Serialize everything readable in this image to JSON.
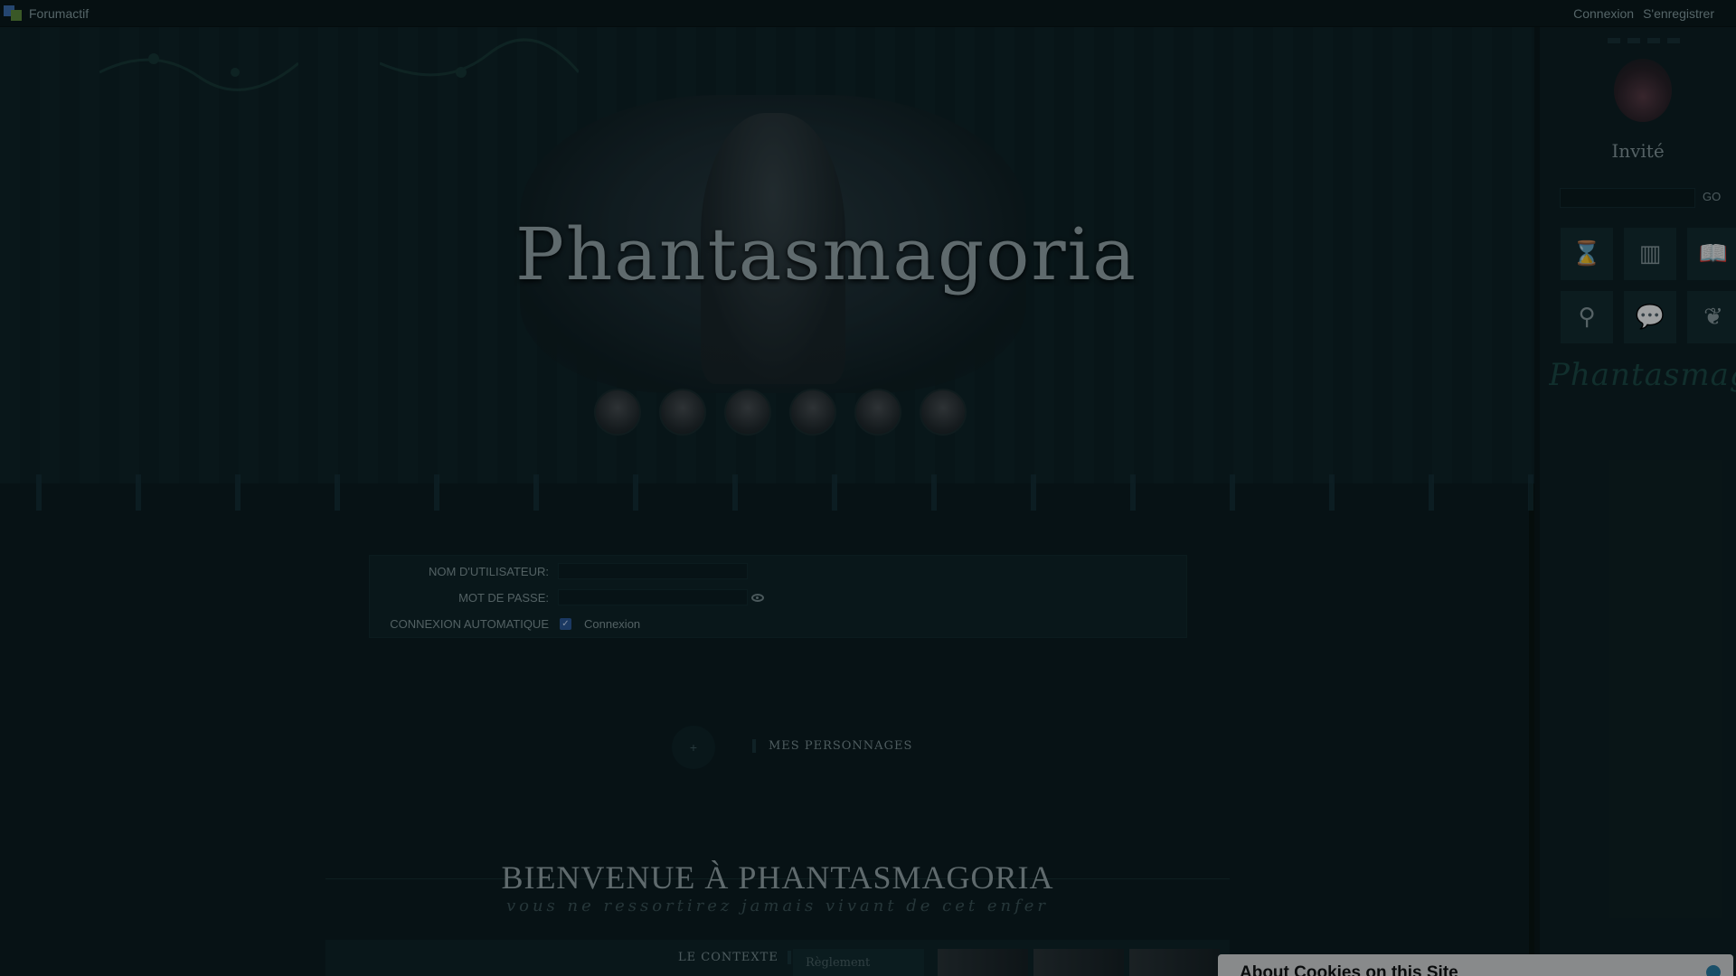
{
  "topbar": {
    "brand": "Forumactif",
    "connexion": "Connexion",
    "register": "S'enregistrer"
  },
  "header": {
    "title": "Phantasmagoria",
    "avatar_count": 6
  },
  "login": {
    "username_label": "NOM D'UTILISATEUR:",
    "password_label": "MOT DE PASSE:",
    "autologin_label": "CONNEXION AUTOMATIQUE",
    "submit": "Connexion",
    "username_value": "",
    "password_value": ""
  },
  "characters": {
    "add": "+",
    "label": "MES PERSONNAGES"
  },
  "welcome": {
    "title": "BIENVENUE À PHANTASMAGORIA",
    "subtitle": "vous ne ressortirez jamais vivant de cet enfer"
  },
  "content": {
    "contexte": "LE CONTEXTE",
    "reglement": "Règlement"
  },
  "sidebar": {
    "user": "Invité",
    "go": "GO",
    "logo": "Phantasmagoria",
    "icons": [
      "hourglass-icon",
      "books-icon",
      "open-book-icon",
      "magnifier-icon",
      "chat-icon",
      "map-icon"
    ],
    "glyphs": [
      "⌛",
      "▥",
      "📖",
      "⚲",
      "💬",
      "❦"
    ]
  },
  "cookie": {
    "title": "About Cookies on this Site"
  },
  "colors": {
    "background": "#0a1517",
    "panel": "#0f2326",
    "text": "#8fa3a6",
    "checkbox": "#2d5a9a"
  }
}
